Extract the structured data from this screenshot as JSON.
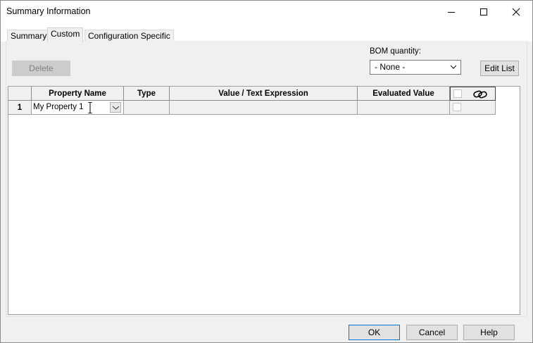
{
  "window": {
    "title": "Summary Information",
    "minimize_icon": "minimize-icon",
    "maximize_icon": "maximize-icon",
    "close_icon": "close-icon"
  },
  "tabs": [
    {
      "label": "Summary",
      "active": false
    },
    {
      "label": "Custom",
      "active": true
    },
    {
      "label": "Configuration Specific",
      "active": false
    }
  ],
  "toolbar": {
    "delete_label": "Delete",
    "bom_quantity_label": "BOM quantity:",
    "bom_quantity_value": "- None -",
    "edit_list_label": "Edit List"
  },
  "table": {
    "columns": [
      "Property Name",
      "Type",
      "Value / Text Expression",
      "Evaluated Value"
    ],
    "link_icon": "link-icon",
    "rows": [
      {
        "number": "1",
        "property_name": "My Property 1",
        "type": "",
        "value": "",
        "evaluated_value": ""
      }
    ]
  },
  "footer": {
    "ok_label": "OK",
    "cancel_label": "Cancel",
    "help_label": "Help"
  }
}
